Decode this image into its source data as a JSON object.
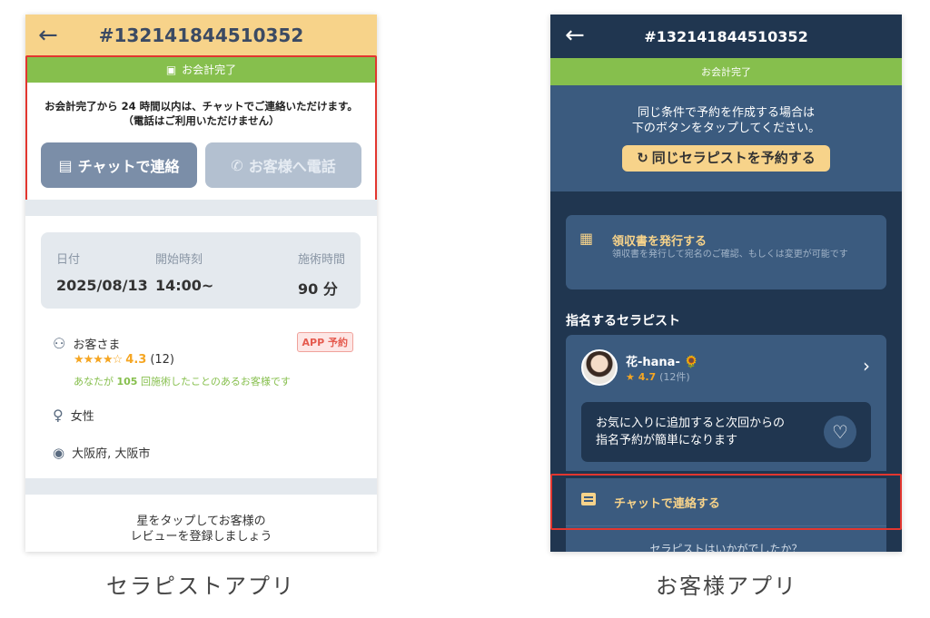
{
  "therapist_app": {
    "caption": "セラピストアプリ",
    "header": {
      "title": "#132141844510352"
    },
    "status_banner": "お会計完了",
    "notice_line1": "お会計完了から 24 時間以内は、チャットでご連絡いただけます。",
    "notice_line2": "（電話はご利用いただけません）",
    "chat_button": "チャットで連絡",
    "call_button": "お客様へ電話",
    "booking": {
      "date_label": "日付",
      "date_value": "2025/08/13",
      "start_label": "開始時刻",
      "start_value": "14:00~",
      "duration_label": "施術時間",
      "duration_value": "90 分"
    },
    "customer": {
      "name": "お客さま",
      "badge": "APP 予約",
      "rating": "4.3",
      "reviews": "(12)",
      "repeat_prefix": "あなたが",
      "repeat_count": "105",
      "repeat_suffix": "回施術したことのあるお客様です",
      "gender": "女性",
      "location": "大阪府, 大阪市"
    },
    "review_prompt_line1": "星をタップしてお客様の",
    "review_prompt_line2": "レビューを登録しましょう"
  },
  "customer_app": {
    "caption": "お客様アプリ",
    "header": {
      "title": "#132141844510352"
    },
    "status_banner": "お会計完了",
    "repeat_line1": "同じ条件で予約を作成する場合は",
    "repeat_line2": "下のボタンをタップしてください。",
    "rebook_button": "同じセラピストを予約する",
    "receipt_title": "領収書を発行する",
    "receipt_desc": "領収書を発行して宛名のご確認、もしくは変更が可能です",
    "section_title": "指名するセラピスト",
    "therapist_name": "花-hana- 🌻",
    "therapist_rating": "4.7",
    "therapist_reviews": "(12件)",
    "favorite_line1": "お気に入りに追加すると次回からの",
    "favorite_line2": "指名予約が簡単になります",
    "chat_label": "チャットで連絡する",
    "question": "セラピストはいかがでしたか？"
  },
  "colors": {
    "yellow": "#f7d38a",
    "green": "#86bf4d",
    "navy": "#203650",
    "blue": "#3b5b7f",
    "highlight": "#e2362f"
  }
}
